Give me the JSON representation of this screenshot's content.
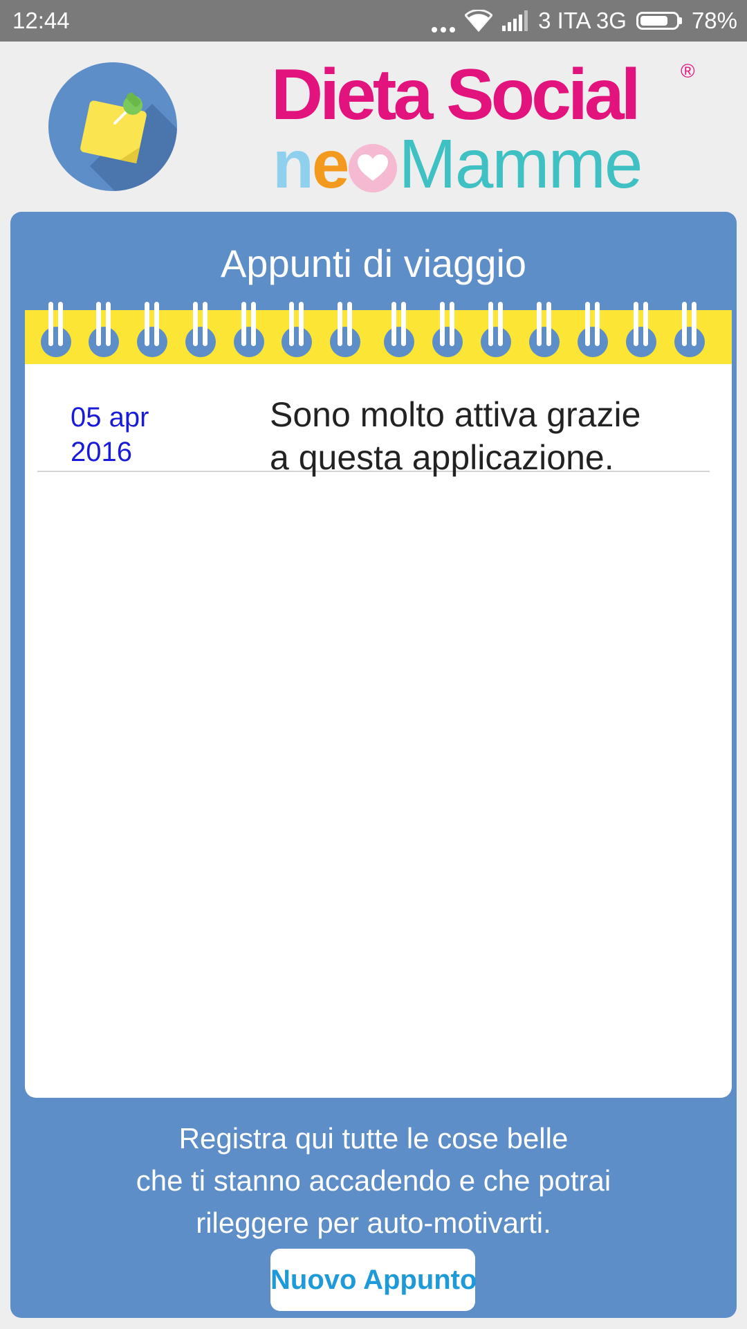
{
  "status_bar": {
    "time": "12:44",
    "carrier": "3 ITA 3G",
    "battery": "78%",
    "battery_level": 0.78
  },
  "header": {
    "icon": "sticky-note-icon",
    "logo": {
      "line1": "Dieta Social",
      "registered": "®",
      "neo_n": "n",
      "neo_e": "e",
      "mamme": "Mamme"
    }
  },
  "panel": {
    "title": "Appunti di viaggio",
    "entries": [
      {
        "date_line1": "05 apr",
        "date_line2": "2016",
        "text_line1": "Sono molto attiva grazie",
        "text_line2": "a questa applicazione."
      }
    ],
    "description_lines": [
      "Registra qui tutte le cose belle",
      "che ti stanno accadendo e che potrai",
      "rileggere per auto-motivarti."
    ],
    "new_button_label": "Nuovo Appunto"
  },
  "colors": {
    "panel": "#5d8ec8",
    "binding": "#fce534",
    "brand_pink": "#e2137d",
    "brand_teal": "#3fc0c3",
    "date_blue": "#1a1adb",
    "button_text": "#1f9ad8"
  }
}
